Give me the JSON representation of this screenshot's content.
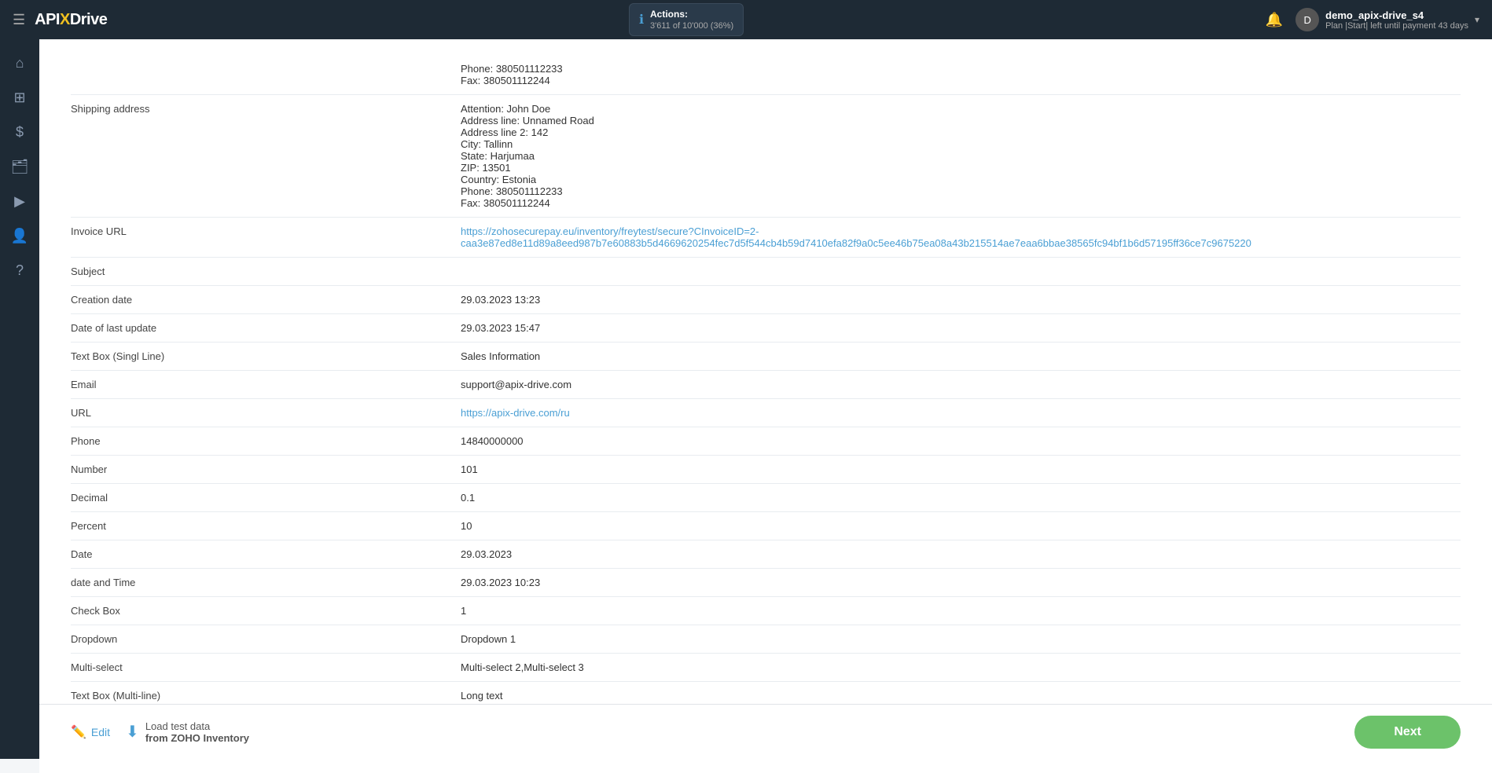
{
  "header": {
    "hamburger": "☰",
    "logo_api": "API",
    "logo_x": "X",
    "logo_drive": "Drive",
    "actions_label": "Actions:",
    "actions_count": "3'611 of 10'000 (36%)",
    "actions_percent": "36%",
    "user_name": "demo_apix-drive_s4",
    "user_plan": "Plan |Start| left until payment 43 days",
    "user_initials": "D",
    "chevron": "▾"
  },
  "sidebar": {
    "items": [
      {
        "icon": "⌂",
        "name": "home"
      },
      {
        "icon": "⊞",
        "name": "connections"
      },
      {
        "icon": "$",
        "name": "billing"
      },
      {
        "icon": "🗂",
        "name": "projects"
      },
      {
        "icon": "▶",
        "name": "play"
      },
      {
        "icon": "👤",
        "name": "profile"
      },
      {
        "icon": "?",
        "name": "help"
      }
    ]
  },
  "table": {
    "rows": [
      {
        "label": "Shipping address",
        "value": "Attention: John Doe\nAddress line: Unnamed Road\nAddress line 2: 142\nCity: Tallinn\nState: Harjumaa\nZIP: 13501\nCountry: Estonia\nPhone: 380501112233\nFax: 380501112244",
        "is_link": false
      },
      {
        "label": "Invoice URL",
        "value": "https://zohosecurepay.eu/inventory/freytest/secure?CInvoiceID=2-caa3e87ed8e11d89a8eed987b7e60883b5d4669620254fec7d5f544cb4b59d7410efa82f9a0c5ee46b75ea08a43b215514ae7eaa6bbae38565fc94bf1b6d57195ff36ce7c9675220",
        "is_link": true
      },
      {
        "label": "Subject",
        "value": "",
        "is_link": false
      },
      {
        "label": "Creation date",
        "value": "29.03.2023 13:23",
        "is_link": false
      },
      {
        "label": "Date of last update",
        "value": "29.03.2023 15:47",
        "is_link": false
      },
      {
        "label": "Text Box (Singl Line)",
        "value": "Sales Information",
        "is_link": false
      },
      {
        "label": "Email",
        "value": "support@apix-drive.com",
        "is_link": false
      },
      {
        "label": "URL",
        "value": "https://apix-drive.com/ru",
        "is_link": true
      },
      {
        "label": "Phone",
        "value": "14840000000",
        "is_link": false
      },
      {
        "label": "Number",
        "value": "101",
        "is_link": false
      },
      {
        "label": "Decimal",
        "value": "0.1",
        "is_link": false
      },
      {
        "label": "Percent",
        "value": "10",
        "is_link": false
      },
      {
        "label": "Date",
        "value": "29.03.2023",
        "is_link": false
      },
      {
        "label": "date and Time",
        "value": "29.03.2023 10:23",
        "is_link": false
      },
      {
        "label": "Check Box",
        "value": "1",
        "is_link": false
      },
      {
        "label": "Dropdown",
        "value": "Dropdown 1",
        "is_link": false
      },
      {
        "label": "Multi-select",
        "value": "Multi-select 2,Multi-select 3",
        "is_link": false
      },
      {
        "label": "Text Box (Multi-line)",
        "value": "Long text",
        "is_link": false
      }
    ]
  },
  "bottom_bar": {
    "edit_label": "Edit",
    "load_label": "Load test data",
    "load_sub": "from ZOHO Inventory",
    "next_label": "Next"
  },
  "above_table": {
    "phone_fax": "Phone: 380501112233\nFax: 380501112244"
  }
}
